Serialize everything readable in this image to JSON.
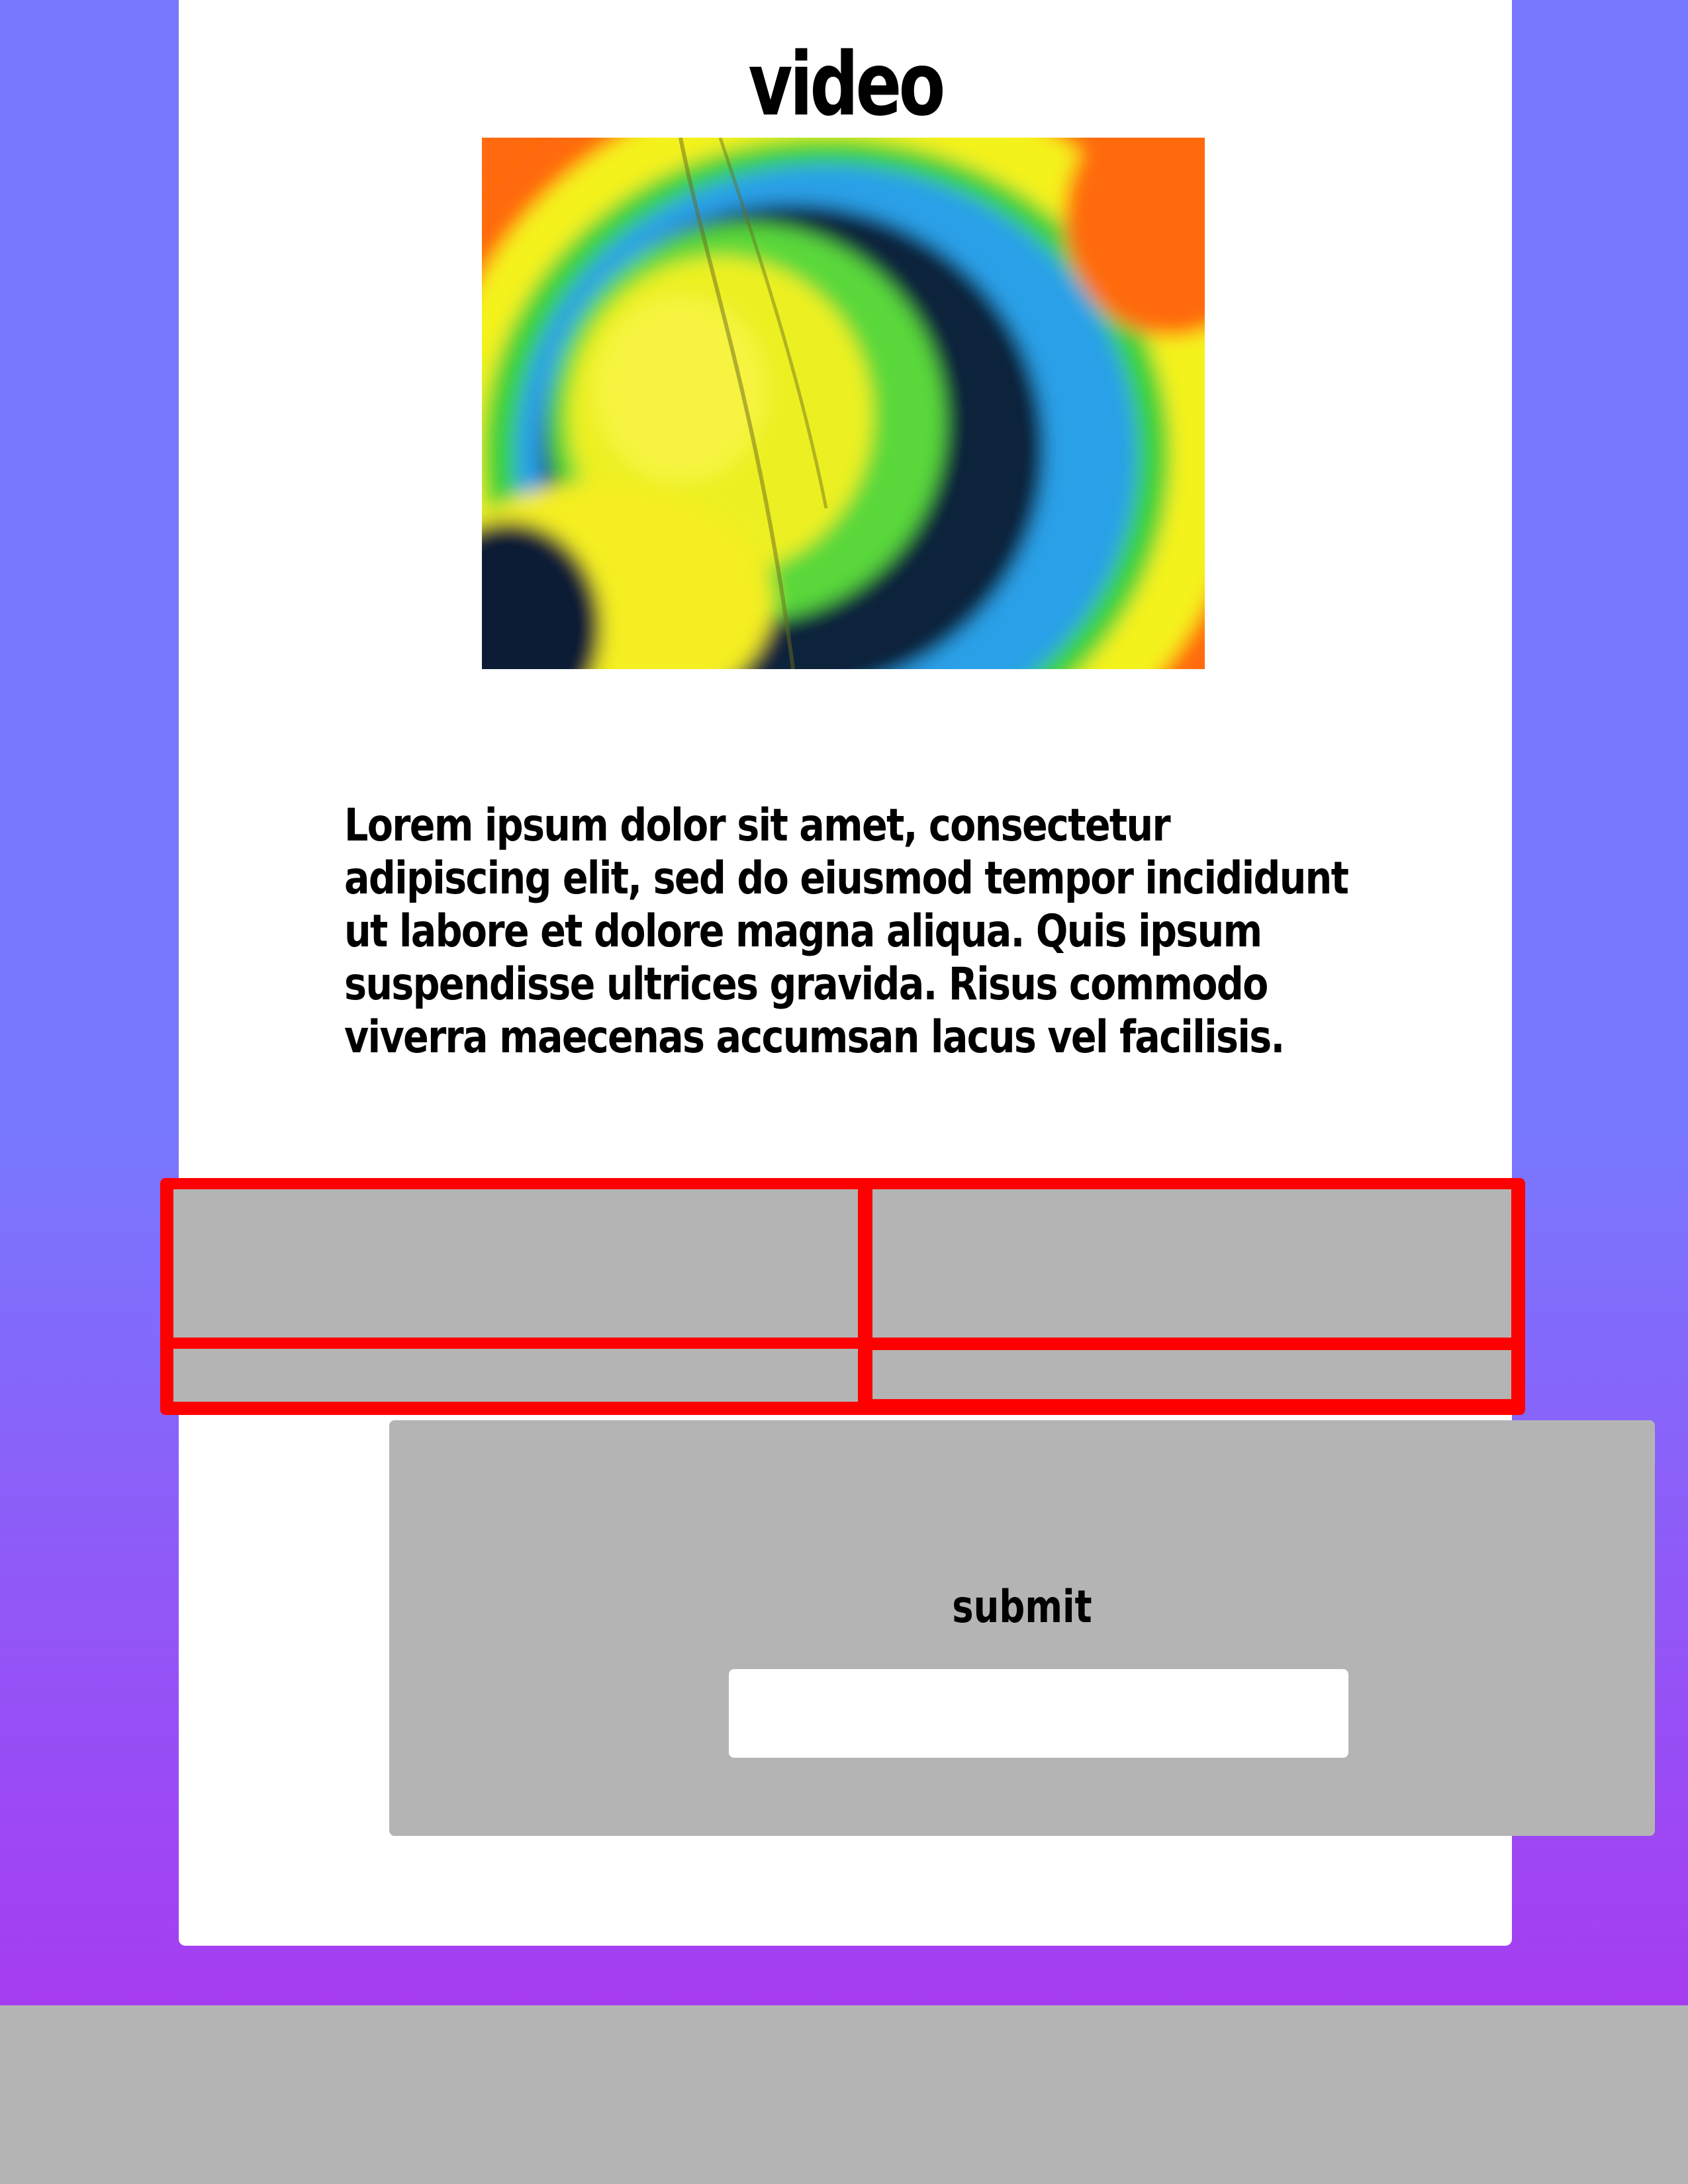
{
  "header": {
    "title": "video"
  },
  "video": {
    "icon": "tie-dye-video-thumbnail"
  },
  "content": {
    "paragraph": "Lorem ipsum dolor sit amet, consectetur adipiscing elit, sed do eiusmod tempor incididunt ut labore et dolore magna aliqua. Quis ipsum suspendisse ultrices gravida. Risus commodo viverra maecenas accumsan lacus vel facilisis."
  },
  "form": {
    "submit_label": "submit",
    "input_value": "",
    "input_placeholder": ""
  },
  "colors": {
    "background_top": "#7878ff",
    "background_bottom": "#a63cf0",
    "card": "#ffffff",
    "panel": "#b4b4b4",
    "grid_border": "#ff0000"
  }
}
